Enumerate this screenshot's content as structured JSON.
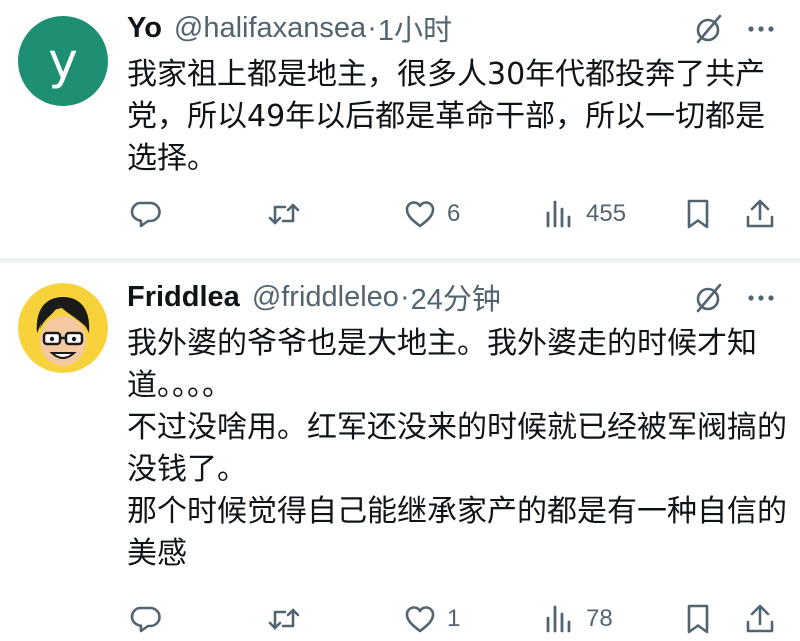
{
  "tweets": [
    {
      "name": "Yo",
      "handle": "@halifaxansea",
      "separator": "·",
      "time": "1小时",
      "avatar_letter": "y",
      "avatar_color": "#1f8f73",
      "text": [
        "我家祖上都是地主，很多人30年代都投奔了共产党，所以49年以后都是革命干部，所以一切都是选择。"
      ],
      "likes": "6",
      "views": "455"
    },
    {
      "name": "Friddlea",
      "handle": "@friddleleo",
      "separator": "·",
      "time": "24分钟",
      "avatar": "cartoon-glasses-avatar",
      "text": [
        "我外婆的爷爷也是大地主。我外婆走的时候才知道。。。。",
        "不过没啥用。红军还没来的时候就已经被军阀搞的没钱了。",
        "那个时候觉得自己能继承家产的都是有一种自信的美感"
      ],
      "likes": "1",
      "views": "78"
    }
  ],
  "icons": {
    "reply": "reply-icon",
    "retweet": "retweet-icon",
    "like": "heart-icon",
    "views": "views-icon",
    "bookmark": "bookmark-icon",
    "share": "share-icon",
    "grok": "grok-icon",
    "more": "more-icon"
  },
  "colors": {
    "text": "#0f1419",
    "muted": "#536471",
    "divider": "#eff3f4",
    "avatar_yo": "#1f8f73",
    "avatar_friddlea_bg": "#f7d23a"
  }
}
